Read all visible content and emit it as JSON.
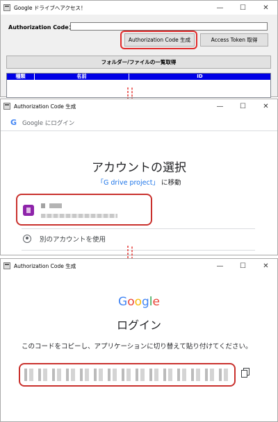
{
  "win1": {
    "title": "Google ドライブへアクセス！",
    "auth_label": "Authorization Code：",
    "auth_value": "",
    "gen_button": "Authorization Code 生成",
    "token_button": "Access Token 取得",
    "list_button": "フォルダー/ファイルの一覧取得",
    "columns": [
      "種類",
      "名前",
      "ID"
    ]
  },
  "win2": {
    "title": "Authorization Code 生成",
    "google_bar_text": "Google にログイン",
    "heading": "アカウントの選択",
    "project_name": "「G drive project」",
    "redirect_text": "に移動",
    "other_account": "別のアカウントを使用"
  },
  "win3": {
    "title": "Authorization Code 生成",
    "logo_letters": [
      "G",
      "o",
      "o",
      "g",
      "l",
      "e"
    ],
    "heading": "ログイン",
    "instruction": "このコードをコピーし、アプリケーションに切り替えて貼り付けてください。"
  },
  "window_controls": {
    "minimize": "—",
    "maximize": "☐",
    "close": "✕"
  },
  "colors": {
    "highlight": "#c9302c",
    "grid_header": "#0000e6",
    "link": "#1a73e8"
  }
}
